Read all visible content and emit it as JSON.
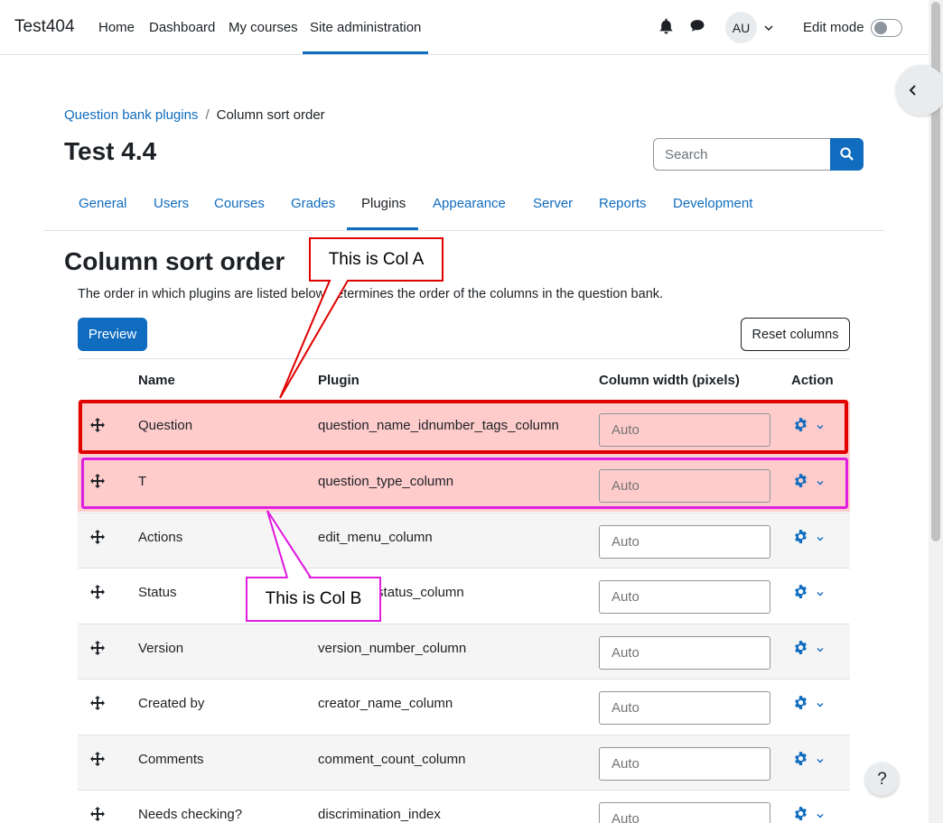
{
  "site": {
    "brand": "Test404"
  },
  "primary_nav": [
    "Home",
    "Dashboard",
    "My courses",
    "Site administration"
  ],
  "user": {
    "initials": "AU",
    "edit_mode_label": "Edit mode",
    "edit_mode_on": false
  },
  "breadcrumb": {
    "parent": "Question bank plugins",
    "current": "Column sort order"
  },
  "page_title": "Test 4.4",
  "search": {
    "placeholder": "Search"
  },
  "secondary_nav": [
    "General",
    "Users",
    "Courses",
    "Grades",
    "Plugins",
    "Appearance",
    "Server",
    "Reports",
    "Development"
  ],
  "secondary_nav_active": "Plugins",
  "section": {
    "title": "Column sort order",
    "intro": "The order in which plugins are listed below determines the order of the columns in the question bank."
  },
  "buttons": {
    "preview": "Preview",
    "reset": "Reset columns"
  },
  "table": {
    "headers": {
      "name": "Name",
      "plugin": "Plugin",
      "width": "Column width (pixels)",
      "action": "Action"
    },
    "width_placeholder": "Auto",
    "rows": [
      {
        "name": "Question",
        "plugin": "question_name_idnumber_tags_column"
      },
      {
        "name": "T",
        "plugin": "question_type_column"
      },
      {
        "name": "Actions",
        "plugin": "edit_menu_column"
      },
      {
        "name": "Status",
        "plugin": "question_status_column"
      },
      {
        "name": "Version",
        "plugin": "version_number_column"
      },
      {
        "name": "Created by",
        "plugin": "creator_name_column"
      },
      {
        "name": "Comments",
        "plugin": "comment_count_column"
      },
      {
        "name": "Needs checking?",
        "plugin": "discrimination_index"
      }
    ]
  },
  "annotations": {
    "col_a": "This is Col A",
    "col_b": "This is Col B",
    "col_a_color": "#e00000",
    "col_b_color": "#e01ee0"
  },
  "colors": {
    "brand_blue": "#0f6cbf",
    "highlight_row": "#ffcccc"
  },
  "help": "?"
}
